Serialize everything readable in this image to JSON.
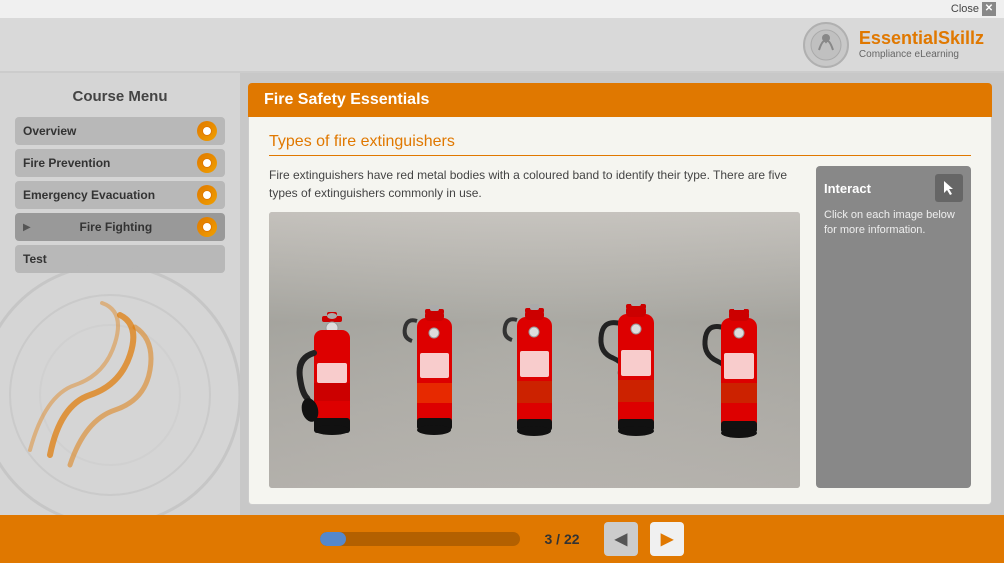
{
  "topbar": {
    "close_label": "Close"
  },
  "logo": {
    "brand_part1": "Essential",
    "brand_part2": "Skillz",
    "subtitle": "Compliance eLearning"
  },
  "header": {
    "title": "Fire Safety Essentials"
  },
  "sidebar": {
    "title": "Course Menu",
    "items": [
      {
        "id": "overview",
        "label": "Overview",
        "has_icon": true,
        "has_arrow": false
      },
      {
        "id": "fire-prevention",
        "label": "Fire Prevention",
        "has_icon": true,
        "has_arrow": false
      },
      {
        "id": "emergency-evacuation",
        "label": "Emergency Evacuation",
        "has_icon": true,
        "has_arrow": false
      },
      {
        "id": "fire-fighting",
        "label": "Fire Fighting",
        "has_icon": true,
        "has_arrow": true
      },
      {
        "id": "test",
        "label": "Test",
        "has_icon": false,
        "has_arrow": false
      }
    ]
  },
  "slide": {
    "title": "Types of fire extinguishers",
    "description": "Fire extinguishers have red metal bodies with a coloured band to identify their type. There are five types of extinguishers commonly in use.",
    "interact": {
      "title": "Interact",
      "instruction": "Click on each image below for more information."
    }
  },
  "footer": {
    "progress_percent": 13,
    "current_page": "3",
    "total_pages": "22",
    "page_display": "3 / 22"
  },
  "icons": {
    "cursor": "🖱",
    "prev_arrow": "◀",
    "next_arrow": "▶",
    "close_x": "✕"
  }
}
